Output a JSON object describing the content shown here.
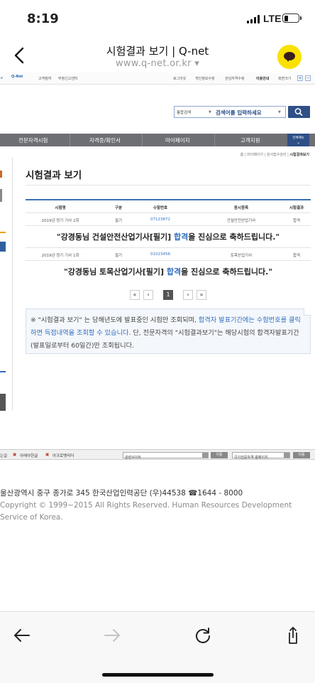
{
  "status_bar": {
    "time": "8:19",
    "network": "LTE",
    "battery_level": 0.25
  },
  "browser": {
    "page_title": "시험결과 보기 | Q-net",
    "url": "www.q-net.or.kr ▾"
  },
  "site": {
    "utility": {
      "logo": "Q-Net",
      "left_links": [
        "고객참여",
        "부정신고센터"
      ],
      "right_links": [
        "로그아웃",
        "개인정보수정",
        "관심자격수정",
        "이용안내",
        "화면크기"
      ],
      "zoom_in": "+",
      "zoom_out": "−"
    },
    "search": {
      "category": "통합검색",
      "placeholder": "검색어를 입력하세요"
    },
    "gnb": [
      "전문자격시험",
      "자격증/확인서",
      "마이페이지",
      "고객지원"
    ],
    "gnb_all": "전체메뉴",
    "breadcrumb": {
      "path": "홈 | 마이페이지 | 원서접수관리 | ",
      "current": "시험결과보기"
    },
    "page_title": "시험결과 보기",
    "table": {
      "headers": [
        "시험명",
        "구분",
        "수험번호",
        "응시종목",
        "시험결과"
      ],
      "results": [
        {
          "exam": "2019년 정기 기사 2회",
          "type": "필기",
          "number": "07123872",
          "subject": "건설안전산업기사",
          "result": "합격",
          "msg_prefix": "\"강경동님 건설안전산업기사[필기] ",
          "msg_pass": "합격",
          "msg_suffix": "을 진심으로 축하드립니다.\""
        },
        {
          "exam": "2019년 정기 기사 1회",
          "type": "필기",
          "number": "01023456",
          "subject": "토목산업기사",
          "result": "합격",
          "msg_prefix": "\"강경동님 토목산업기사[필기] ",
          "msg_pass": "합격",
          "msg_suffix": "을 진심으로 축하드립니다.\""
        }
      ]
    },
    "pagination": {
      "first": "«",
      "prev": "‹",
      "current": "1",
      "next": "›",
      "last": "»"
    },
    "notice": {
      "part1": "※ \"시험결과 보기\" 는 당해년도에 발표중인 시험만 조회되며, ",
      "highlight": "합격자 발표기간에는 수험번호를 클릭하면 득점내역을 조회할 수 있습니다",
      "part2": ". 단, 전문자격의 \"시험결과보기\"는 해당시험의 합격자발표기간(발표일로부터 60일간)만 조회됩니다."
    },
    "footer_bar": {
      "label": "는길",
      "viewer1": "아래아한글",
      "viewer2": "아크로뱃리더",
      "select1": "관련사이트",
      "go1": "이동",
      "select2": "국가전문자격 홈페이지",
      "go2": "이동"
    },
    "address": "울산광역시 중구 종가로 345 한국산업인력공단 (우)44538 ☎1644 - 8000",
    "copyright": "Copyright © 1999~2015 All Rights Reserved. Human Resources Development Service of Korea."
  },
  "colors": {
    "accent": "#2f6fc0",
    "nav_bg": "#6d6f74",
    "kakao": "#fae100"
  }
}
